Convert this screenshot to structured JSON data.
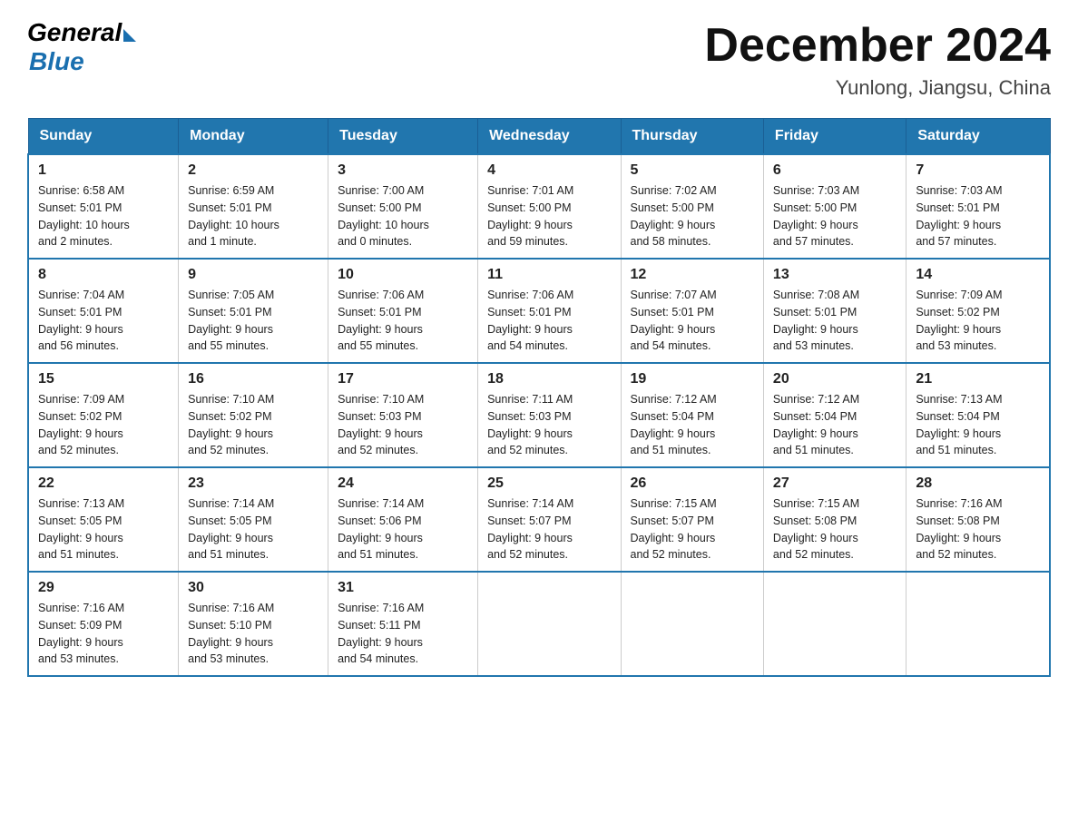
{
  "header": {
    "logo_general": "General",
    "logo_blue": "Blue",
    "title": "December 2024",
    "location": "Yunlong, Jiangsu, China"
  },
  "days_of_week": [
    "Sunday",
    "Monday",
    "Tuesday",
    "Wednesday",
    "Thursday",
    "Friday",
    "Saturday"
  ],
  "weeks": [
    [
      {
        "day": "1",
        "sunrise": "6:58 AM",
        "sunset": "5:01 PM",
        "daylight": "10 hours and 2 minutes."
      },
      {
        "day": "2",
        "sunrise": "6:59 AM",
        "sunset": "5:01 PM",
        "daylight": "10 hours and 1 minute."
      },
      {
        "day": "3",
        "sunrise": "7:00 AM",
        "sunset": "5:00 PM",
        "daylight": "10 hours and 0 minutes."
      },
      {
        "day": "4",
        "sunrise": "7:01 AM",
        "sunset": "5:00 PM",
        "daylight": "9 hours and 59 minutes."
      },
      {
        "day": "5",
        "sunrise": "7:02 AM",
        "sunset": "5:00 PM",
        "daylight": "9 hours and 58 minutes."
      },
      {
        "day": "6",
        "sunrise": "7:03 AM",
        "sunset": "5:00 PM",
        "daylight": "9 hours and 57 minutes."
      },
      {
        "day": "7",
        "sunrise": "7:03 AM",
        "sunset": "5:01 PM",
        "daylight": "9 hours and 57 minutes."
      }
    ],
    [
      {
        "day": "8",
        "sunrise": "7:04 AM",
        "sunset": "5:01 PM",
        "daylight": "9 hours and 56 minutes."
      },
      {
        "day": "9",
        "sunrise": "7:05 AM",
        "sunset": "5:01 PM",
        "daylight": "9 hours and 55 minutes."
      },
      {
        "day": "10",
        "sunrise": "7:06 AM",
        "sunset": "5:01 PM",
        "daylight": "9 hours and 55 minutes."
      },
      {
        "day": "11",
        "sunrise": "7:06 AM",
        "sunset": "5:01 PM",
        "daylight": "9 hours and 54 minutes."
      },
      {
        "day": "12",
        "sunrise": "7:07 AM",
        "sunset": "5:01 PM",
        "daylight": "9 hours and 54 minutes."
      },
      {
        "day": "13",
        "sunrise": "7:08 AM",
        "sunset": "5:01 PM",
        "daylight": "9 hours and 53 minutes."
      },
      {
        "day": "14",
        "sunrise": "7:09 AM",
        "sunset": "5:02 PM",
        "daylight": "9 hours and 53 minutes."
      }
    ],
    [
      {
        "day": "15",
        "sunrise": "7:09 AM",
        "sunset": "5:02 PM",
        "daylight": "9 hours and 52 minutes."
      },
      {
        "day": "16",
        "sunrise": "7:10 AM",
        "sunset": "5:02 PM",
        "daylight": "9 hours and 52 minutes."
      },
      {
        "day": "17",
        "sunrise": "7:10 AM",
        "sunset": "5:03 PM",
        "daylight": "9 hours and 52 minutes."
      },
      {
        "day": "18",
        "sunrise": "7:11 AM",
        "sunset": "5:03 PM",
        "daylight": "9 hours and 52 minutes."
      },
      {
        "day": "19",
        "sunrise": "7:12 AM",
        "sunset": "5:04 PM",
        "daylight": "9 hours and 51 minutes."
      },
      {
        "day": "20",
        "sunrise": "7:12 AM",
        "sunset": "5:04 PM",
        "daylight": "9 hours and 51 minutes."
      },
      {
        "day": "21",
        "sunrise": "7:13 AM",
        "sunset": "5:04 PM",
        "daylight": "9 hours and 51 minutes."
      }
    ],
    [
      {
        "day": "22",
        "sunrise": "7:13 AM",
        "sunset": "5:05 PM",
        "daylight": "9 hours and 51 minutes."
      },
      {
        "day": "23",
        "sunrise": "7:14 AM",
        "sunset": "5:05 PM",
        "daylight": "9 hours and 51 minutes."
      },
      {
        "day": "24",
        "sunrise": "7:14 AM",
        "sunset": "5:06 PM",
        "daylight": "9 hours and 51 minutes."
      },
      {
        "day": "25",
        "sunrise": "7:14 AM",
        "sunset": "5:07 PM",
        "daylight": "9 hours and 52 minutes."
      },
      {
        "day": "26",
        "sunrise": "7:15 AM",
        "sunset": "5:07 PM",
        "daylight": "9 hours and 52 minutes."
      },
      {
        "day": "27",
        "sunrise": "7:15 AM",
        "sunset": "5:08 PM",
        "daylight": "9 hours and 52 minutes."
      },
      {
        "day": "28",
        "sunrise": "7:16 AM",
        "sunset": "5:08 PM",
        "daylight": "9 hours and 52 minutes."
      }
    ],
    [
      {
        "day": "29",
        "sunrise": "7:16 AM",
        "sunset": "5:09 PM",
        "daylight": "9 hours and 53 minutes."
      },
      {
        "day": "30",
        "sunrise": "7:16 AM",
        "sunset": "5:10 PM",
        "daylight": "9 hours and 53 minutes."
      },
      {
        "day": "31",
        "sunrise": "7:16 AM",
        "sunset": "5:11 PM",
        "daylight": "9 hours and 54 minutes."
      },
      null,
      null,
      null,
      null
    ]
  ]
}
